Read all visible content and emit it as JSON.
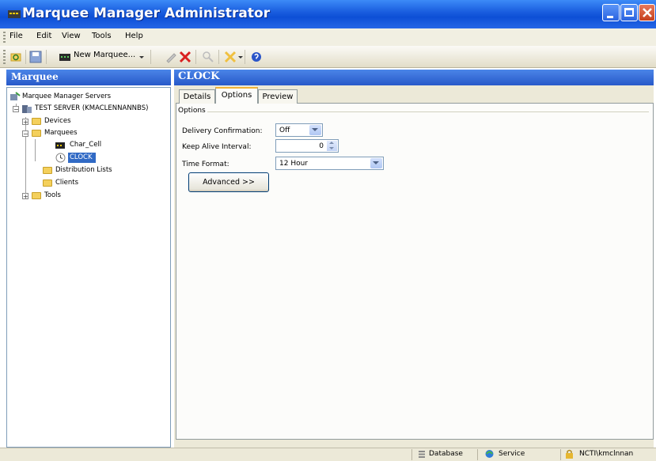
{
  "window": {
    "title": "Marquee Manager Administrator"
  },
  "menu": [
    "File",
    "Edit",
    "View",
    "Tools",
    "Help"
  ],
  "toolbar": {
    "new_marquee_label": "New Marquee..."
  },
  "left_pane": {
    "header": "Marquee",
    "tree": {
      "root": "Marquee Manager Servers",
      "server": "TEST SERVER (KMACLENNANNBS)",
      "devices": "Devices",
      "marquees": "Marquees",
      "char_cell": "Char_Cell",
      "clock": "CLOCK",
      "distribution_lists": "Distribution Lists",
      "clients": "Clients",
      "tools": "Tools"
    }
  },
  "right_pane": {
    "header": "CLOCK",
    "tabs": [
      "Details",
      "Options",
      "Preview"
    ],
    "active_tab": "Options",
    "group_label": "Options",
    "fields": {
      "delivery_confirmation": {
        "label": "Delivery Confirmation:",
        "value": "Off"
      },
      "keep_alive_interval": {
        "label": "Keep Alive Interval:",
        "value": "0"
      },
      "time_format": {
        "label": "Time Format:",
        "value": "12 Hour"
      }
    },
    "advanced_button": "Advanced >>"
  },
  "status_bar": {
    "database": "Database",
    "service": "Service",
    "user": "NCTI\\kmclnnan"
  },
  "colors": {
    "title_bar": "#0d4fd6",
    "pane_header": "#2759c9",
    "selected_item": "#316ac5",
    "tab_highlight": "#f1b336"
  }
}
